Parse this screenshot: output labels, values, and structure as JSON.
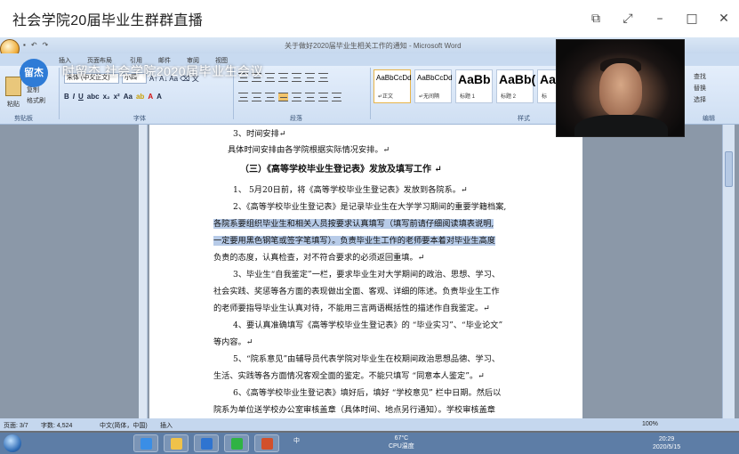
{
  "window": {
    "title": "社会学院20届毕业生群群直播",
    "controls": [
      "share-icon",
      "fullscreen-icon",
      "minimize-icon",
      "maximize-icon",
      "close-icon"
    ]
  },
  "word": {
    "title": "关于做好2020届毕业生相关工作的通知 - Microsoft Word",
    "tabs": [
      "插入",
      "页面布局",
      "引用",
      "邮件",
      "审阅",
      "视图"
    ],
    "clipboard": {
      "paste": "粘贴",
      "cut": "剪切",
      "copy": "复制",
      "format_painter": "格式刷",
      "label": "剪贴板"
    },
    "font": {
      "name": "宋体 (中文正文)",
      "size": "小四",
      "label": "字体"
    },
    "paragraph_label": "段落",
    "styles_label": "样式",
    "styles": [
      {
        "preview": "AaBbCcDd",
        "name": "↵正文"
      },
      {
        "preview": "AaBbCcDd",
        "name": "↵无间隔"
      },
      {
        "preview": "AaBb",
        "name": "标题 1"
      },
      {
        "preview": "AaBb(",
        "name": "标题 2"
      },
      {
        "preview": "AaBb",
        "name": "标"
      }
    ],
    "editing": {
      "find": "查找",
      "replace": "替换",
      "select": "选择",
      "label": "编辑"
    }
  },
  "overlay": {
    "badge": "留杰",
    "title": "时留杰 社会学院2020届毕业生会议"
  },
  "document": {
    "lines": [
      "3、时间安排↵",
      "具体时间安排由各学院根据实际情况安排。↵",
      "（三）《高等学校毕业生登记表》发放及填写工作  ↵",
      "1、 5月20日前，将《高等学校毕业生登记表》发放到各院系。↵",
      "2、《高等学校毕业生登记表》是记录毕业生在大学学习期间的重要学籍档案,",
      "各院系要组织毕业生和相关人员按要求认真填写（填写前请仔细阅读填表说明,",
      "一定要用黑色钢笔或签字笔填写）。负责毕业生工作的老师要本着对毕业生高度",
      "负责的态度，认真检查，对不符合要求的必须返回重填。↵",
      "3、毕业生“自我鉴定”一栏，要求毕业生对大学期间的政治、思想、学习、",
      "社会实践、奖惩等各方面的表现做出全面、客观、详细的陈述。负责毕业生工作",
      "的老师要指导毕业生认真对待，不能用三言两语概括性的描述作自我鉴定。↵",
      "4、要认真准确填写《高等学校毕业生登记表》的 “毕业实习”、“毕业论文”",
      "等内容。↵",
      "5、“院系意见”由辅导员代表学院对毕业生在校期间政治思想品德、学习、",
      "生活、实践等各方面情况客观全面的鉴定。不能只填写 “同意本人鉴定”。↵",
      "6、《高等学校毕业生登记表》填好后，填好 “学校意见” 栏中日期。然后以",
      "院系为单位送学校办公室审核盖章（具体时间、地点另行通知）。学校审核盖章"
    ]
  },
  "statusbar": {
    "page": "页面: 3/7",
    "words": "字数: 4,524",
    "lang": "中文(简体，中国)",
    "mode": "插入",
    "zoom": "100%"
  },
  "taskbar": {
    "ime": "中",
    "temp": "67°C",
    "temp_label": "CPU温度",
    "time": "20:29",
    "date": "2020/5/15"
  }
}
